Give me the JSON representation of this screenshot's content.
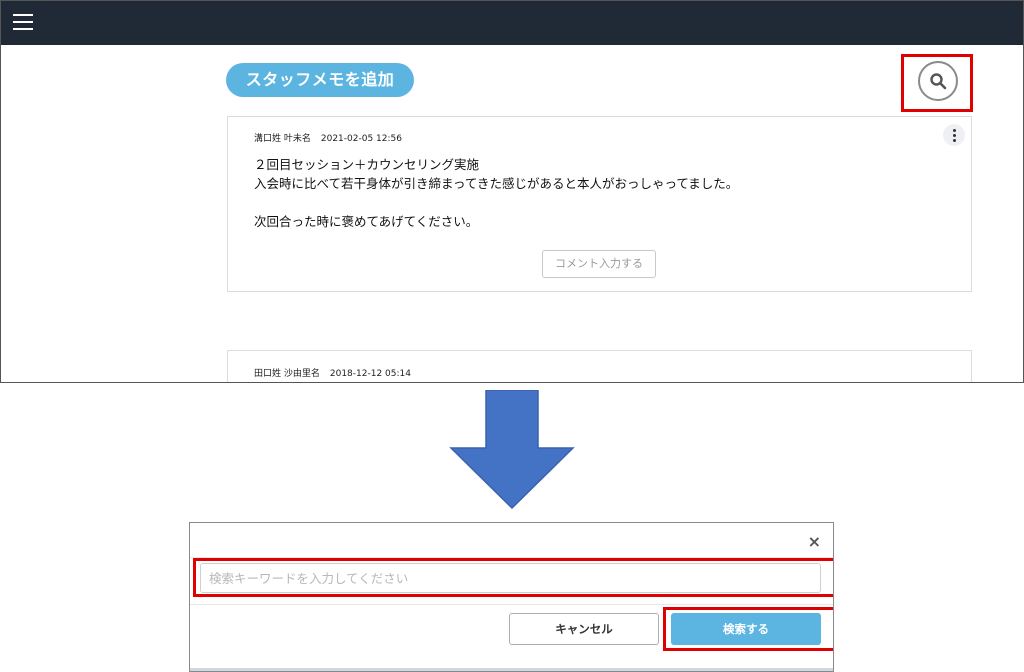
{
  "header": {
    "menu_icon": "hamburger-menu-icon",
    "background_color": "#1f2a36"
  },
  "memo_list": {
    "add_memo_label": "スタッフメモを追加",
    "search_icon": "magnifier-icon",
    "accent_color": "#5cb4e1",
    "memos": [
      {
        "author": "溝口姓 叶未名",
        "date": "2021-02-05 12:56",
        "lines": [
          "２回目セッション＋カウンセリング実施",
          "入会時に比べて若干身体が引き締まってきた感じがあると本人がおっしゃってました。",
          "",
          "次回合った時に褒めてあげてください。"
        ],
        "comment_button": "コメント入力する"
      },
      {
        "author": "田口姓 沙由里名",
        "date": "2018-12-12 05:14"
      }
    ]
  },
  "search_dialog": {
    "close_label": "×",
    "input_placeholder": "検索キーワードを入力してください",
    "input_value": "",
    "cancel_label": "キャンセル",
    "submit_label": "検索する"
  },
  "annotations": {
    "highlight_color": "#e00000",
    "arrow_color": "#4472c4"
  }
}
